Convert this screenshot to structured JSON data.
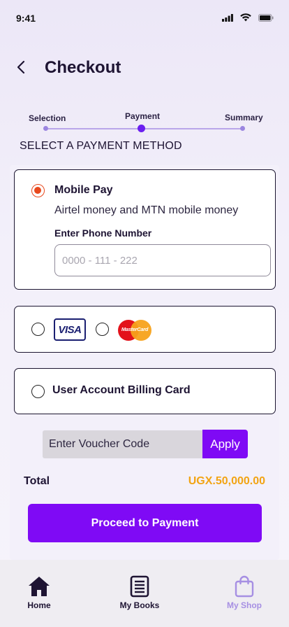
{
  "status_bar": {
    "time": "9:41",
    "icons": [
      "signal-icon",
      "wifi-icon",
      "battery-icon"
    ]
  },
  "header": {
    "title": "Checkout",
    "back_icon": "chevron-left-icon"
  },
  "stepper": {
    "steps": [
      {
        "label": "Selection",
        "state": "done"
      },
      {
        "label": "Payment",
        "state": "active"
      },
      {
        "label": "Summary",
        "state": "pending"
      }
    ]
  },
  "section_title": "SELECT A PAYMENT METHOD",
  "payment_methods": {
    "mobile_pay": {
      "title": "Mobile Pay",
      "subtitle": "Airtel money and MTN mobile money",
      "phone_label": "Enter Phone Number",
      "phone_placeholder": "0000 - 111 - 222",
      "phone_value": "",
      "selected": true
    },
    "cards": {
      "visa_text": "VISA",
      "mastercard_text": "MasterCard",
      "visa_selected": false,
      "mastercard_selected": false
    },
    "billing_card": {
      "label": "User Account Billing Card",
      "selected": false
    }
  },
  "voucher": {
    "placeholder": "Enter Voucher Code",
    "apply_label": "Apply"
  },
  "total": {
    "label": "Total",
    "value": "UGX.50,000.00"
  },
  "proceed_label": "Proceed to Payment",
  "bottom_nav": {
    "items": [
      {
        "label": "Home",
        "icon": "home-icon"
      },
      {
        "label": "My Books",
        "icon": "book-icon"
      },
      {
        "label": "My Shop",
        "icon": "shopping-bag-icon"
      }
    ]
  },
  "colors": {
    "accent": "#7f0af5",
    "radio_selected": "#e8491d",
    "total_value": "#f2a413",
    "nav_inactive": "#a68fe3"
  }
}
